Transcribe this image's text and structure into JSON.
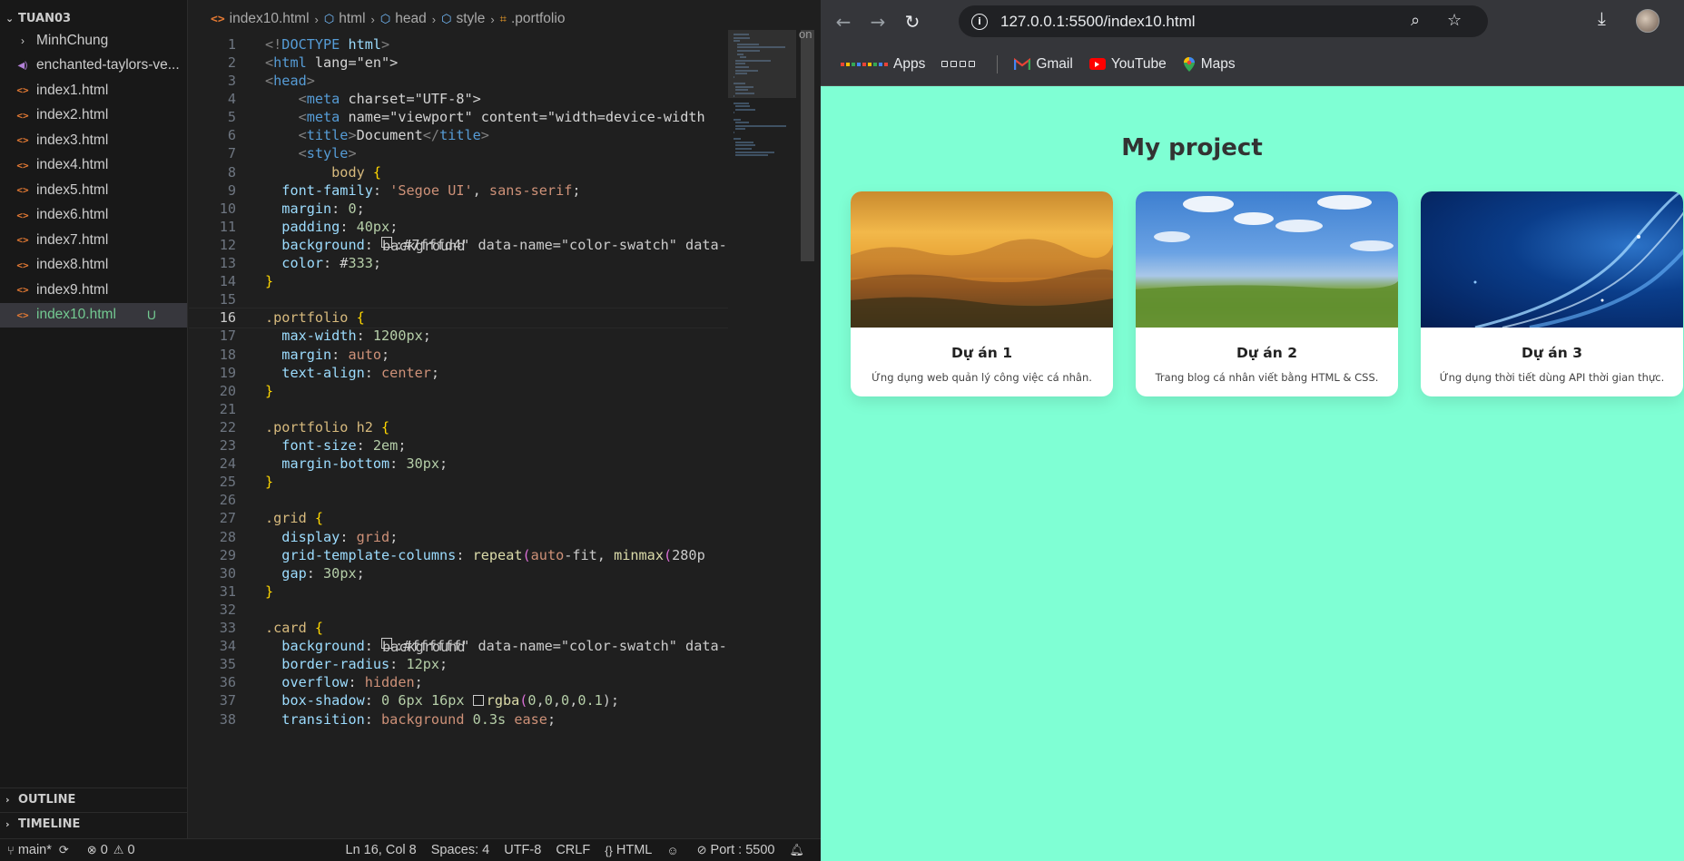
{
  "explorer": {
    "root": "TUAN03",
    "items": [
      {
        "label": "MinhChung",
        "kind": "folder"
      },
      {
        "label": "enchanted-taylors-ve...",
        "kind": "audio"
      },
      {
        "label": "index1.html",
        "kind": "html"
      },
      {
        "label": "index2.html",
        "kind": "html"
      },
      {
        "label": "index3.html",
        "kind": "html"
      },
      {
        "label": "index4.html",
        "kind": "html"
      },
      {
        "label": "index5.html",
        "kind": "html"
      },
      {
        "label": "index6.html",
        "kind": "html"
      },
      {
        "label": "index7.html",
        "kind": "html"
      },
      {
        "label": "index8.html",
        "kind": "html"
      },
      {
        "label": "index9.html",
        "kind": "html"
      },
      {
        "label": "index10.html",
        "kind": "html",
        "badge": "U",
        "active": true
      }
    ],
    "outline": "OUTLINE",
    "timeline": "TIMELINE"
  },
  "breadcrumb": {
    "file": "index10.html",
    "html": "html",
    "head": "head",
    "style": "style",
    "selector": ".portfolio",
    "overflow": "on"
  },
  "code_lines": [
    "<!DOCTYPE html>",
    "<html lang=\"en\">",
    "<head>",
    "    <meta charset=\"UTF-8\">",
    "    <meta name=\"viewport\" content=\"width=device-width",
    "    <title>Document</title>",
    "    <style>",
    "        body {",
    "  font-family: 'Segoe UI', sans-serif;",
    "  margin: 0;",
    "  padding: 40px;",
    "  background: aquamarine;",
    "  color: #333;",
    "}",
    "",
    ".portfolio {",
    "  max-width: 1200px;",
    "  margin: auto;",
    "  text-align: center;",
    "}",
    "",
    ".portfolio h2 {",
    "  font-size: 2em;",
    "  margin-bottom: 30px;",
    "}",
    "",
    ".grid {",
    "  display: grid;",
    "  grid-template-columns: repeat(auto-fit, minmax(280p",
    "  gap: 30px;",
    "}",
    "",
    ".card {",
    "  background: white;",
    "  border-radius: 12px;",
    "  overflow: hidden;",
    "  box-shadow: 0 6px 16px rgba(0,0,0,0.1);",
    "  transition: background 0.3s ease;"
  ],
  "current_line": 16,
  "statusbar": {
    "branch": "main*",
    "errors": "0",
    "warnings": "0",
    "position": "Ln 16, Col 8",
    "spaces": "Spaces: 4",
    "encoding": "UTF-8",
    "eol": "CRLF",
    "language": "HTML",
    "port": "Port : 5500"
  },
  "browser": {
    "url": "127.0.0.1:5500/index10.html",
    "bookmarks": [
      "Apps",
      "Gmail",
      "YouTube",
      "Maps"
    ],
    "page": {
      "heading": "My project",
      "background": "#7fffd4",
      "cards": [
        {
          "title": "Dự án 1",
          "desc": "Ứng dụng web quản lý công việc cá nhân."
        },
        {
          "title": "Dự án 2",
          "desc": "Trang blog cá nhân viết bằng HTML & CSS."
        },
        {
          "title": "Dự án 3",
          "desc": "Ứng dụng thời tiết dùng API thời gian thực."
        }
      ]
    }
  }
}
